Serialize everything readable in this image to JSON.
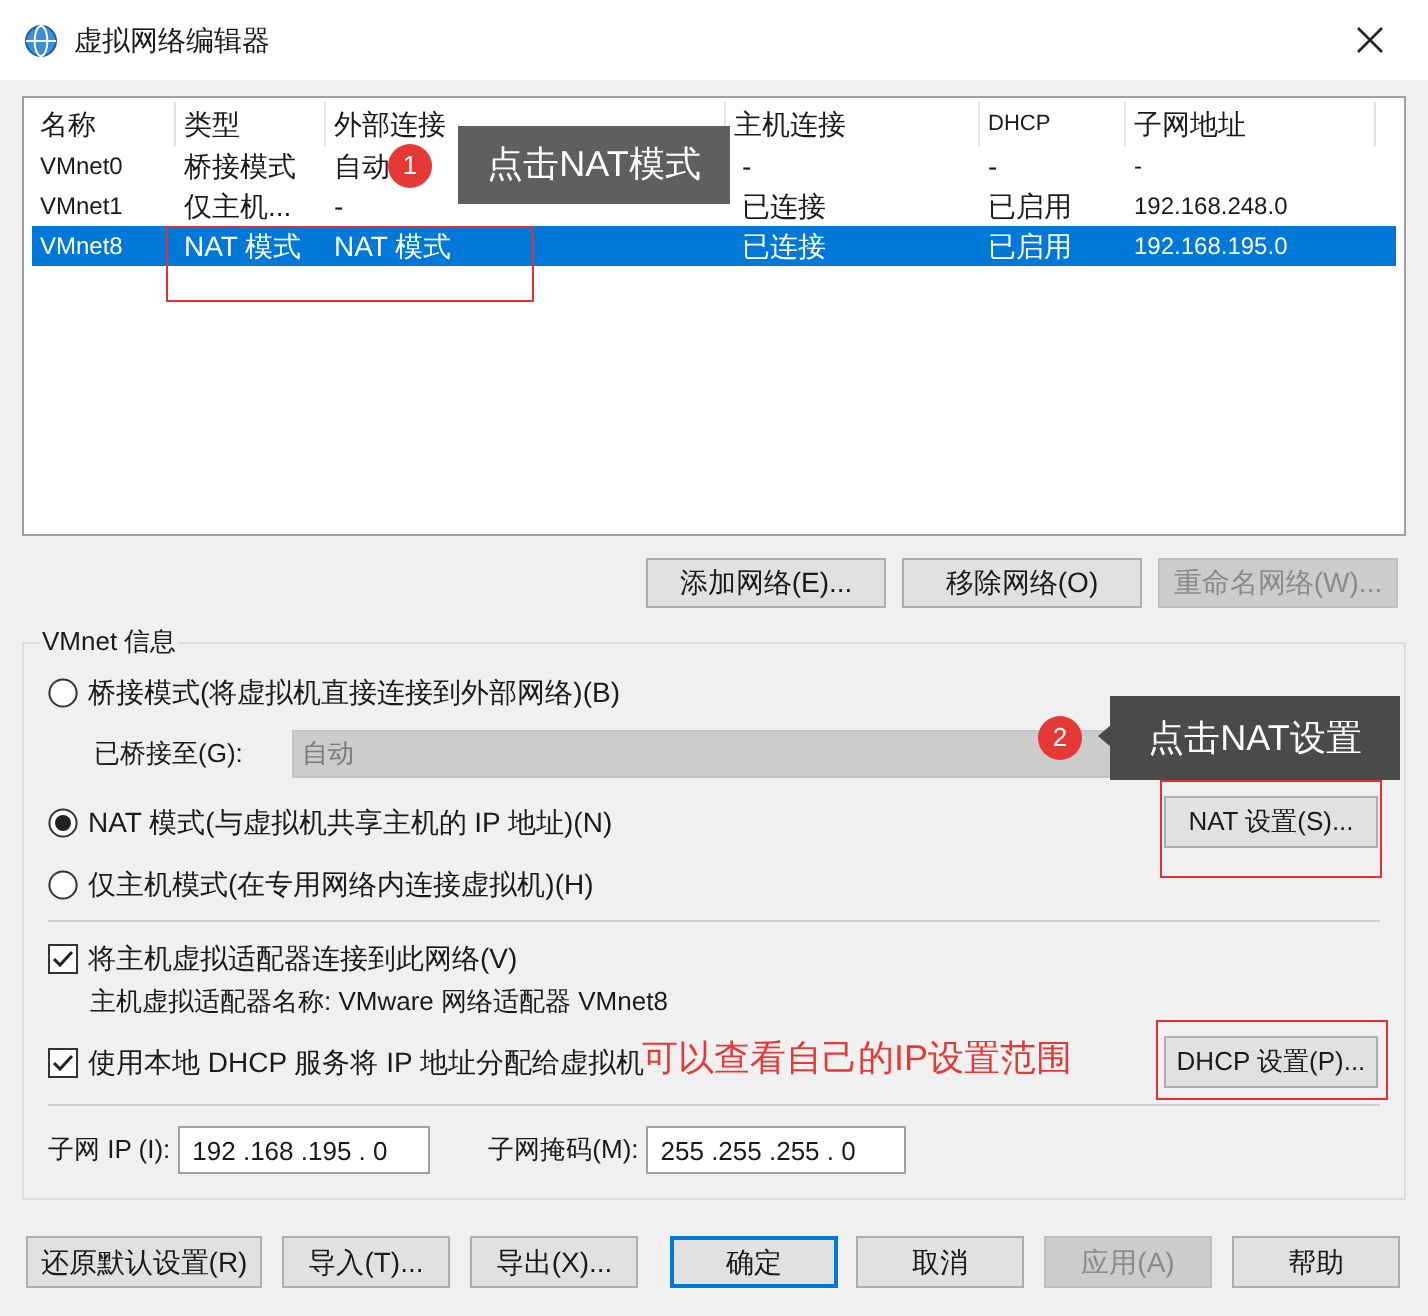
{
  "window": {
    "title": "虚拟网络编辑器"
  },
  "table": {
    "columns": [
      "名称",
      "类型",
      "外部连接",
      "主机连接",
      "DHCP",
      "子网地址"
    ],
    "rows": [
      {
        "cells": [
          "VMnet0",
          "桥接模式",
          "自动",
          "-",
          "-",
          "-"
        ],
        "selected": false
      },
      {
        "cells": [
          "VMnet1",
          "仅主机...",
          "-",
          "已连接",
          "已启用",
          "192.168.248.0"
        ],
        "selected": false
      },
      {
        "cells": [
          "VMnet8",
          "NAT 模式",
          "NAT 模式",
          "已连接",
          "已启用",
          "192.168.195.0"
        ],
        "selected": true
      }
    ]
  },
  "network_buttons": [
    {
      "label": "添加网络(E)...",
      "disabled": false
    },
    {
      "label": "移除网络(O)",
      "disabled": false
    },
    {
      "label": "重命名网络(W)...",
      "disabled": true
    }
  ],
  "vmnet_info": {
    "title": "VMnet 信息",
    "modes": [
      {
        "label": "桥接模式(将虚拟机直接连接到外部网络)(B)",
        "selected": false
      },
      {
        "label": "NAT 模式(与虚拟机共享主机的 IP 地址)(N)",
        "selected": true
      },
      {
        "label": "仅主机模式(在专用网络内连接虚拟机)(H)",
        "selected": false
      }
    ],
    "bridged_to": {
      "label": "已桥接至(G):",
      "value": "自动"
    },
    "nat_settings_button": "NAT 设置(S)...",
    "host_adapter": {
      "label": "将主机虚拟适配器连接到此网络(V)",
      "checked": true
    },
    "adapter_name": "主机虚拟适配器名称: VMware 网络适配器 VMnet8",
    "dhcp": {
      "label": "使用本地 DHCP 服务将 IP 地址分配给虚拟机",
      "checked": true
    },
    "dhcp_settings_button": "DHCP 设置(P)...",
    "subnet_ip": {
      "label": "子网 IP (I):",
      "value": "192 .168 .195 . 0"
    },
    "subnet_mask": {
      "label": "子网掩码(M):",
      "value": "255 .255 .255 . 0"
    }
  },
  "dialog_buttons": [
    {
      "label": "还原默认设置(R)",
      "disabled": false,
      "default": false
    },
    {
      "label": "导入(T)...",
      "disabled": false,
      "default": false
    },
    {
      "label": "导出(X)...",
      "disabled": false,
      "default": false
    },
    {
      "label": "确定",
      "disabled": false,
      "default": true
    },
    {
      "label": "取消",
      "disabled": false,
      "default": false
    },
    {
      "label": "应用(A)",
      "disabled": true,
      "default": false
    },
    {
      "label": "帮助",
      "disabled": false,
      "default": false
    }
  ],
  "annotations": [
    {
      "kind": "callout",
      "badge": "1",
      "text": "点击NAT模式"
    },
    {
      "kind": "callout",
      "badge": "2",
      "text": "点击NAT设置"
    },
    {
      "kind": "note",
      "text": "可以查看自己的IP设置范围"
    }
  ]
}
